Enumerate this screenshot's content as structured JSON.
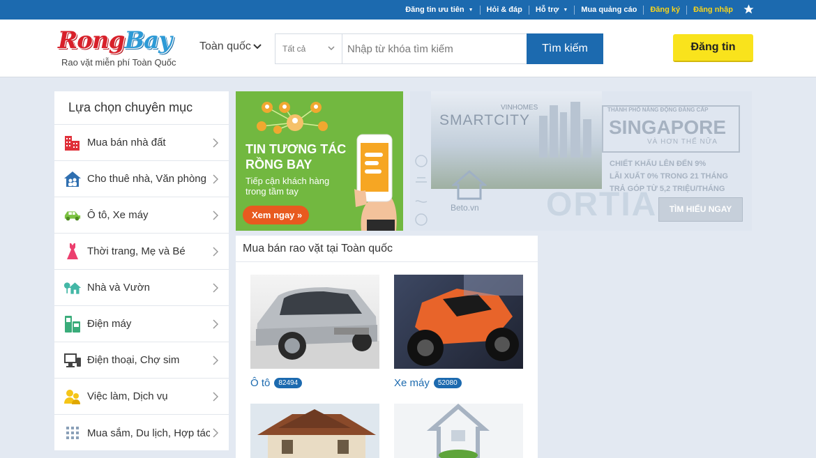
{
  "topbar": {
    "links": [
      {
        "label": "Đăng tin ưu tiên",
        "dropdown": true,
        "highlight": false
      },
      {
        "label": "Hỏi & đáp",
        "dropdown": false,
        "highlight": false
      },
      {
        "label": "Hỗ trợ",
        "dropdown": true,
        "highlight": false
      },
      {
        "label": "Mua quảng cáo",
        "dropdown": false,
        "highlight": false
      },
      {
        "label": "Đăng ký",
        "dropdown": false,
        "highlight": true
      },
      {
        "label": "Đăng nhập",
        "dropdown": false,
        "highlight": true
      }
    ],
    "star_icon": "star-icon"
  },
  "header": {
    "logo_part1": "Rong",
    "logo_part2": "Bay",
    "tagline": "Rao vặt miễn phí Toàn Quốc",
    "location": "Toàn quốc",
    "search": {
      "category": "Tất cả",
      "placeholder": "Nhập từ khóa tìm kiếm",
      "button": "Tìm kiếm"
    },
    "post_button": "Đăng tin"
  },
  "sidebar": {
    "title": "Lựa chọn chuyên mục",
    "items": [
      {
        "label": "Mua bán nhà đất",
        "icon": "building-icon"
      },
      {
        "label": "Cho thuê nhà, Văn phòng",
        "icon": "house-people-icon"
      },
      {
        "label": "Ô tô, Xe máy",
        "icon": "car-icon"
      },
      {
        "label": "Thời trang, Mẹ và Bé",
        "icon": "dress-icon"
      },
      {
        "label": "Nhà và Vườn",
        "icon": "house-tree-icon"
      },
      {
        "label": "Điện máy",
        "icon": "appliance-icon"
      },
      {
        "label": "Điện thoại, Chợ sim",
        "icon": "computer-phone-icon"
      },
      {
        "label": "Việc làm, Dịch vụ",
        "icon": "people-icon"
      },
      {
        "label": "Mua sắm, Du lịch, Hợp tác",
        "icon": "grid-icon"
      }
    ]
  },
  "banner_green": {
    "title_line1": "TIN TƯƠNG TÁC",
    "title_line2": "RỒNG BAY",
    "subtitle": "Tiếp cận khách hàng trong tầm tay",
    "button": "Xem ngay »"
  },
  "banner_blue": {
    "brand_small": "VINHOMES",
    "brand": "SMARTCITY",
    "city_line": "THÀNH PHỐ NĂNG ĐỘNG ĐẲNG CẤP",
    "city": "SINGAPORE",
    "city_more": "VÀ HƠN THẾ NỮA",
    "offer1": "CHIẾT KHẤU LÊN ĐẾN 9%",
    "offer2": "LÃI XUẤT 0% TRONG 21 THÁNG",
    "offer3": "TRẢ GÓP TỪ 5,2 TRIỆU/THÁNG",
    "button": "TÌM HIỂU NGAY",
    "watermark": "Beto.vn",
    "project": "ORTIA"
  },
  "listing": {
    "title": "Mua bán rao vặt tại Toàn quốc",
    "cards": [
      {
        "name": "Ô tô",
        "count": "82494",
        "image": "car-photo"
      },
      {
        "name": "Xe máy",
        "count": "52080",
        "image": "motorbike-photo"
      },
      {
        "name": "",
        "count": "",
        "image": "house-photo"
      },
      {
        "name": "",
        "count": "",
        "image": "eco-house-photo"
      }
    ]
  },
  "colors": {
    "primary": "#1c6aaf",
    "accent_yellow": "#f9e31c",
    "banner_green": "#72b840",
    "background": "#e3e9f2"
  }
}
